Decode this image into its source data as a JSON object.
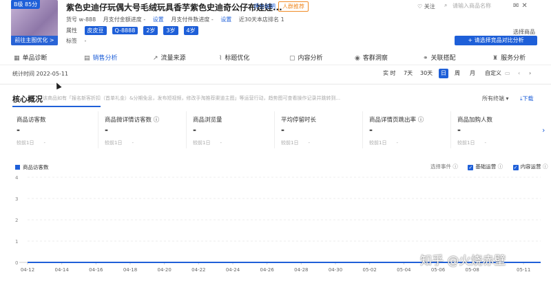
{
  "product": {
    "grade": "B级 85分",
    "thumb_button": "前往主图优化 >",
    "title": "紫色史迪仔玩偶大号毛绒玩具香芋紫色史迪奇公仔布娃娃...",
    "rating_link": "评分说明",
    "recommend_tag": "人群推荐",
    "sku_label": "货号 w-888",
    "pay_amount": "月支付金额进度 -",
    "set1": "设置",
    "pay_count": "月支付件数进度 -",
    "set2": "设置",
    "rank": "近30天本店排名 1",
    "attr_label": "属性",
    "attrs": [
      "皮皮豆",
      "Q-8888",
      "2岁",
      "3岁",
      "4岁"
    ],
    "tag_label": "标签",
    "tag_value": "-"
  },
  "header": {
    "follow": "关注",
    "search_placeholder": "请输入商品名称",
    "select_goods": "选择商品",
    "compare_button": "+ 请选择竞品对比分析"
  },
  "tabs": [
    {
      "label": "单品诊断",
      "icon": "diagnose-icon"
    },
    {
      "label": "销售分析",
      "icon": "sales-icon"
    },
    {
      "label": "流量来源",
      "icon": "traffic-icon"
    },
    {
      "label": "标题优化",
      "icon": "title-icon"
    },
    {
      "label": "内容分析",
      "icon": "content-icon"
    },
    {
      "label": "客群洞察",
      "icon": "customer-icon"
    },
    {
      "label": "关联搭配",
      "icon": "match-icon"
    },
    {
      "label": "服务分析",
      "icon": "service-icon"
    }
  ],
  "timebar": {
    "stat_time": "统计时间 2022-05-11",
    "options": [
      "实 时",
      "7天",
      "30天",
      "日",
      "周",
      "月",
      "自定义"
    ],
    "active": "日"
  },
  "overview": {
    "title": "核心概况",
    "desc": "该商品如有「报名新客折扣（首单礼金）&分期免息，发布短视频，修改手淘推荐渠道主图」等运营行动，趋势图可查看操作记录并跳转到...",
    "all_terms": "所有终端",
    "download": "下载",
    "metrics": [
      {
        "label": "商品访客数",
        "value": "-",
        "compare": "较前1日",
        "cval": "-"
      },
      {
        "label": "商品微详情访客数",
        "value": "-",
        "compare": "较前1日",
        "cval": "-"
      },
      {
        "label": "商品浏览量",
        "value": "-",
        "compare": "较前1日",
        "cval": "-"
      },
      {
        "label": "平均停留时长",
        "value": "-",
        "compare": "较前1日",
        "cval": "-"
      },
      {
        "label": "商品详情页跳出率",
        "value": "-",
        "compare": "较前1日",
        "cval": "-"
      },
      {
        "label": "商品加购人数",
        "value": "-",
        "compare": "较前1日",
        "cval": "-"
      }
    ]
  },
  "events": {
    "label": "选择事件",
    "items": [
      "基础运营",
      "内容运营"
    ]
  },
  "chart_data": {
    "type": "line",
    "series": [
      {
        "name": "商品访客数",
        "values": [
          0,
          0,
          0,
          0,
          0,
          0,
          0,
          0,
          0,
          0,
          0,
          0,
          0,
          0,
          0,
          0,
          0,
          0,
          0,
          0,
          0,
          0,
          0,
          0,
          0,
          0,
          0,
          0,
          0,
          0,
          0
        ]
      }
    ],
    "x": [
      "04-12",
      "04-13",
      "04-14",
      "04-15",
      "04-16",
      "04-17",
      "04-18",
      "04-19",
      "04-20",
      "04-21",
      "04-22",
      "04-23",
      "04-24",
      "04-25",
      "04-26",
      "04-27",
      "04-28",
      "04-29",
      "04-30",
      "05-01",
      "05-02",
      "05-03",
      "05-04",
      "05-05",
      "05-06",
      "05-07",
      "05-08",
      "05-09",
      "05-10",
      "05-11",
      "05-12"
    ],
    "xticks": [
      "04-12",
      "04-14",
      "04-16",
      "04-18",
      "04-20",
      "04-22",
      "04-24",
      "04-26",
      "04-28",
      "04-30",
      "05-02",
      "05-04",
      "05-06",
      "05-08",
      "05-11"
    ],
    "ylim": [
      0,
      4
    ],
    "yticks": [
      0,
      1,
      2,
      3,
      4
    ],
    "color": "#1e5fd8",
    "grid": true
  },
  "watermark": "知乎 @火烧赤壁"
}
